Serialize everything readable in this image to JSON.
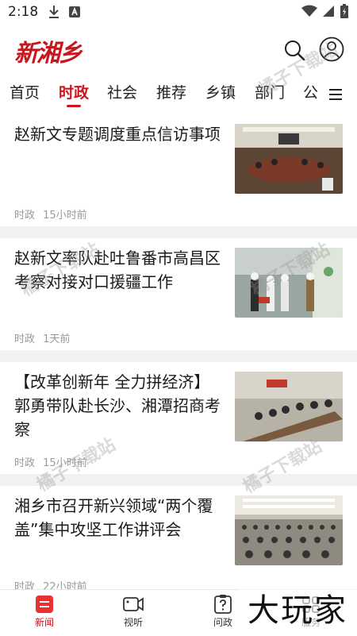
{
  "status": {
    "time": "2:18"
  },
  "header": {
    "logo": "新湘乡"
  },
  "tabs": [
    {
      "label": "首页"
    },
    {
      "label": "时政"
    },
    {
      "label": "社会"
    },
    {
      "label": "推荐"
    },
    {
      "label": "乡镇"
    },
    {
      "label": "部门"
    },
    {
      "label": "公"
    }
  ],
  "news": [
    {
      "title": "赵新文专题调度重点信访事项",
      "category": "时政",
      "time": "15小时前"
    },
    {
      "title": "赵新文率队赴吐鲁番市高昌区考察对接对口援疆工作",
      "category": "时政",
      "time": "1天前"
    },
    {
      "title": "【改革创新年 全力拼经济】郭勇带队赴长沙、湘潭招商考察",
      "category": "时政",
      "time": "15小时前"
    },
    {
      "title": "湘乡市召开新兴领域“两个覆盖”集中攻坚工作讲评会",
      "category": "时政",
      "time": "22小时前"
    }
  ],
  "watermark": "橘子下载站",
  "bottom_nav": [
    {
      "label": "新闻"
    },
    {
      "label": "视听"
    },
    {
      "label": "问政"
    },
    {
      "label": "服务"
    }
  ],
  "corner_brand": "大玩家",
  "colors": {
    "accent": "#d0121b",
    "meta": "#999999"
  }
}
